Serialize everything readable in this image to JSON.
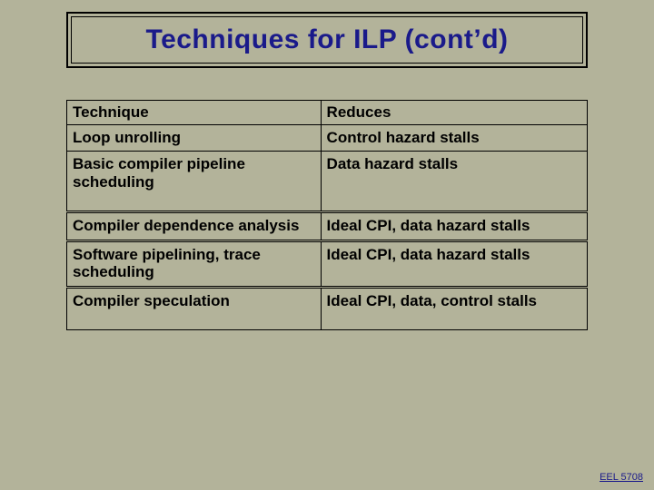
{
  "title": "Techniques for ILP (cont’d)",
  "table": {
    "header": {
      "c1": "Technique",
      "c2": "Reduces"
    },
    "rows": [
      {
        "c1": "Loop unrolling",
        "c2": "Control hazard stalls"
      },
      {
        "c1": "Basic compiler pipeline scheduling",
        "c2": "Data hazard stalls"
      },
      {
        "c1": "Compiler dependence analysis",
        "c2": "Ideal CPI, data hazard stalls"
      },
      {
        "c1": "Software pipelining, trace scheduling",
        "c2": "Ideal CPI, data hazard stalls"
      },
      {
        "c1": "Compiler speculation",
        "c2": "Ideal CPI, data, control stalls"
      }
    ]
  },
  "footer": "EEL 5708"
}
